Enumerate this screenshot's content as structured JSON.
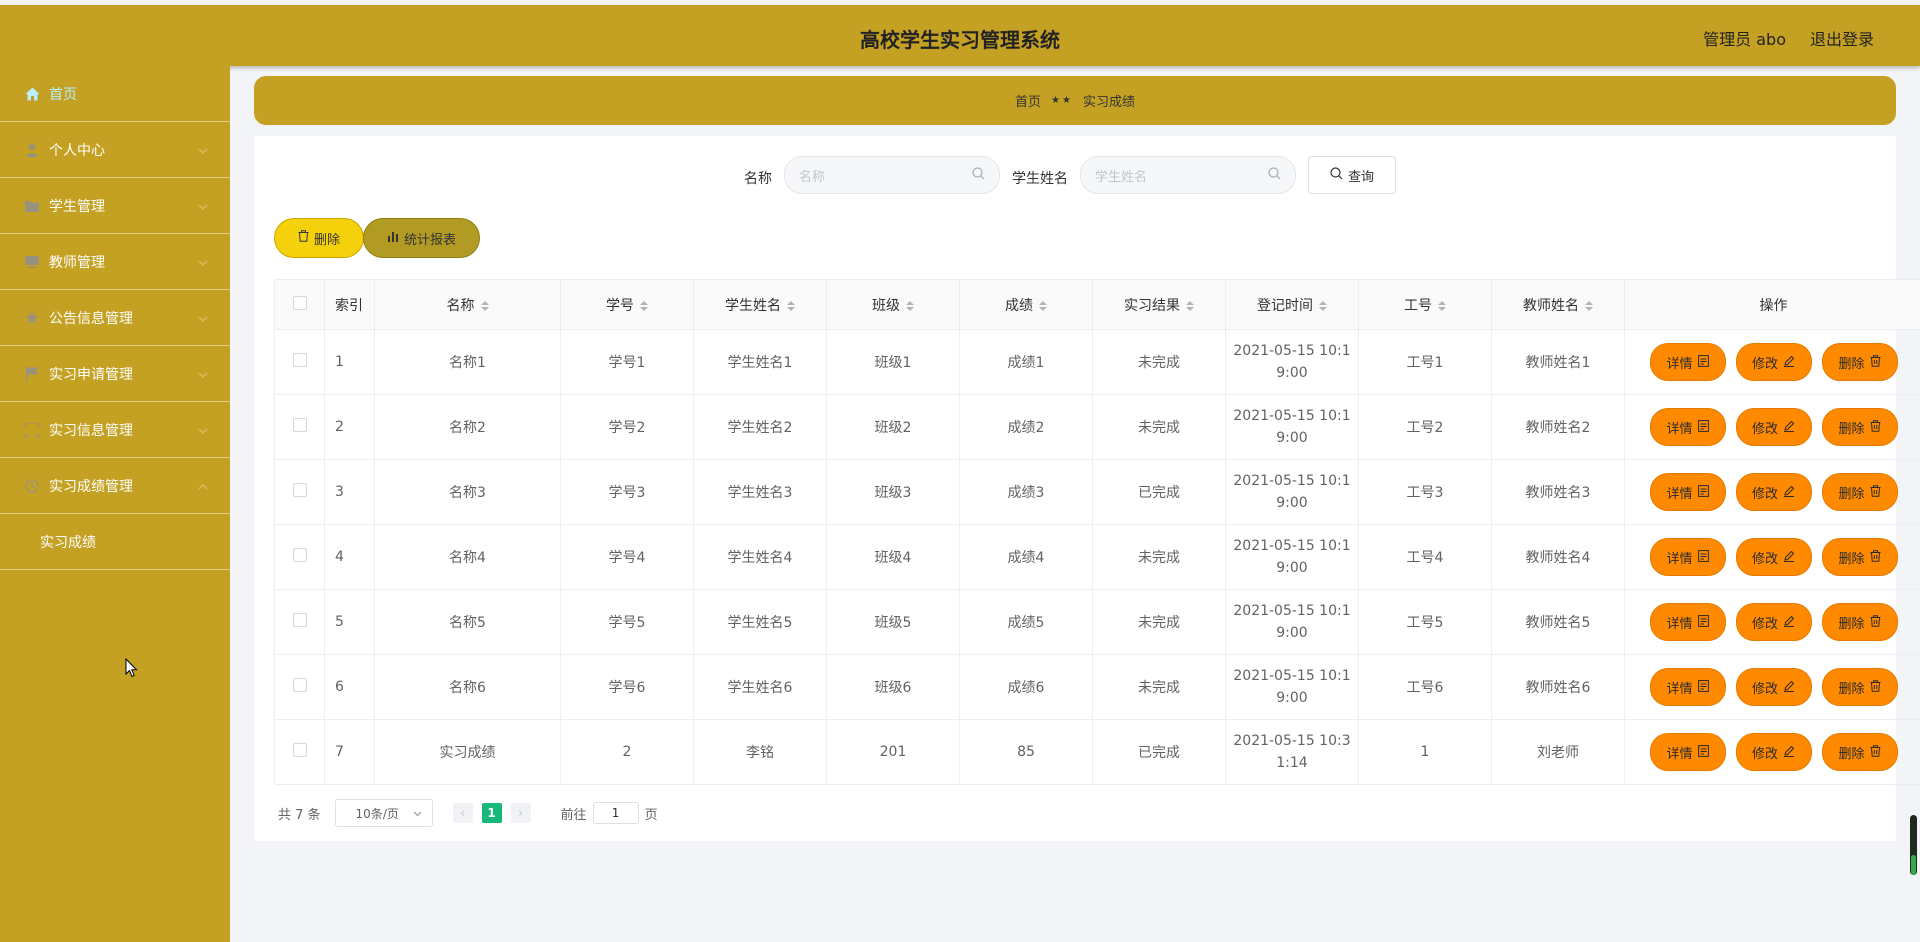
{
  "header": {
    "title": "高校学生实习管理系统",
    "user": "管理员 abo",
    "logout": "退出登录"
  },
  "sidebar": {
    "items": [
      {
        "label": "首页",
        "icon": "home-icon"
      },
      {
        "label": "个人中心",
        "icon": "user-icon"
      },
      {
        "label": "学生管理",
        "icon": "folder-icon"
      },
      {
        "label": "教师管理",
        "icon": "monitor-icon"
      },
      {
        "label": "公告信息管理",
        "icon": "star-icon"
      },
      {
        "label": "实习申请管理",
        "icon": "flag-icon"
      },
      {
        "label": "实习信息管理",
        "icon": "frame-icon"
      },
      {
        "label": "实习成绩管理",
        "icon": "clock-icon"
      }
    ],
    "subitem": "实习成绩"
  },
  "breadcrumb": {
    "home": "首页",
    "sep": "★★",
    "current": "实习成绩"
  },
  "search": {
    "name_label": "名称",
    "name_placeholder": "名称",
    "student_label": "学生姓名",
    "student_placeholder": "学生姓名",
    "query_button": "查询"
  },
  "actions": {
    "delete": "删除",
    "report": "统计报表"
  },
  "table": {
    "columns": [
      "索引",
      "名称",
      "学号",
      "学生姓名",
      "班级",
      "成绩",
      "实习结果",
      "登记时间",
      "工号",
      "教师姓名",
      "操作"
    ],
    "rows": [
      {
        "idx": "1",
        "name": "名称1",
        "sno": "学号1",
        "sname": "学生姓名1",
        "cls": "班级1",
        "score": "成绩1",
        "result": "未完成",
        "time1": "2021-05-15 10:1",
        "time2": "9:00",
        "tno": "工号1",
        "tname": "教师姓名1"
      },
      {
        "idx": "2",
        "name": "名称2",
        "sno": "学号2",
        "sname": "学生姓名2",
        "cls": "班级2",
        "score": "成绩2",
        "result": "未完成",
        "time1": "2021-05-15 10:1",
        "time2": "9:00",
        "tno": "工号2",
        "tname": "教师姓名2"
      },
      {
        "idx": "3",
        "name": "名称3",
        "sno": "学号3",
        "sname": "学生姓名3",
        "cls": "班级3",
        "score": "成绩3",
        "result": "已完成",
        "time1": "2021-05-15 10:1",
        "time2": "9:00",
        "tno": "工号3",
        "tname": "教师姓名3"
      },
      {
        "idx": "4",
        "name": "名称4",
        "sno": "学号4",
        "sname": "学生姓名4",
        "cls": "班级4",
        "score": "成绩4",
        "result": "未完成",
        "time1": "2021-05-15 10:1",
        "time2": "9:00",
        "tno": "工号4",
        "tname": "教师姓名4"
      },
      {
        "idx": "5",
        "name": "名称5",
        "sno": "学号5",
        "sname": "学生姓名5",
        "cls": "班级5",
        "score": "成绩5",
        "result": "未完成",
        "time1": "2021-05-15 10:1",
        "time2": "9:00",
        "tno": "工号5",
        "tname": "教师姓名5"
      },
      {
        "idx": "6",
        "name": "名称6",
        "sno": "学号6",
        "sname": "学生姓名6",
        "cls": "班级6",
        "score": "成绩6",
        "result": "未完成",
        "time1": "2021-05-15 10:1",
        "time2": "9:00",
        "tno": "工号6",
        "tname": "教师姓名6"
      },
      {
        "idx": "7",
        "name": "实习成绩",
        "sno": "2",
        "sname": "李铭",
        "cls": "201",
        "score": "85",
        "result": "已完成",
        "time1": "2021-05-15 10:3",
        "time2": "1:14",
        "tno": "1",
        "tname": "刘老师"
      }
    ],
    "row_actions": {
      "detail": "详情",
      "edit": "修改",
      "delete": "删除"
    }
  },
  "pagination": {
    "total": "共 7 条",
    "page_size": "10条/页",
    "current_page": "1",
    "goto_label": "前往",
    "goto_value": "1",
    "page_suffix": "页"
  },
  "colors": {
    "theme": "#c4a123",
    "action_button": "#ff8a00",
    "pager_active": "#18b77a"
  }
}
